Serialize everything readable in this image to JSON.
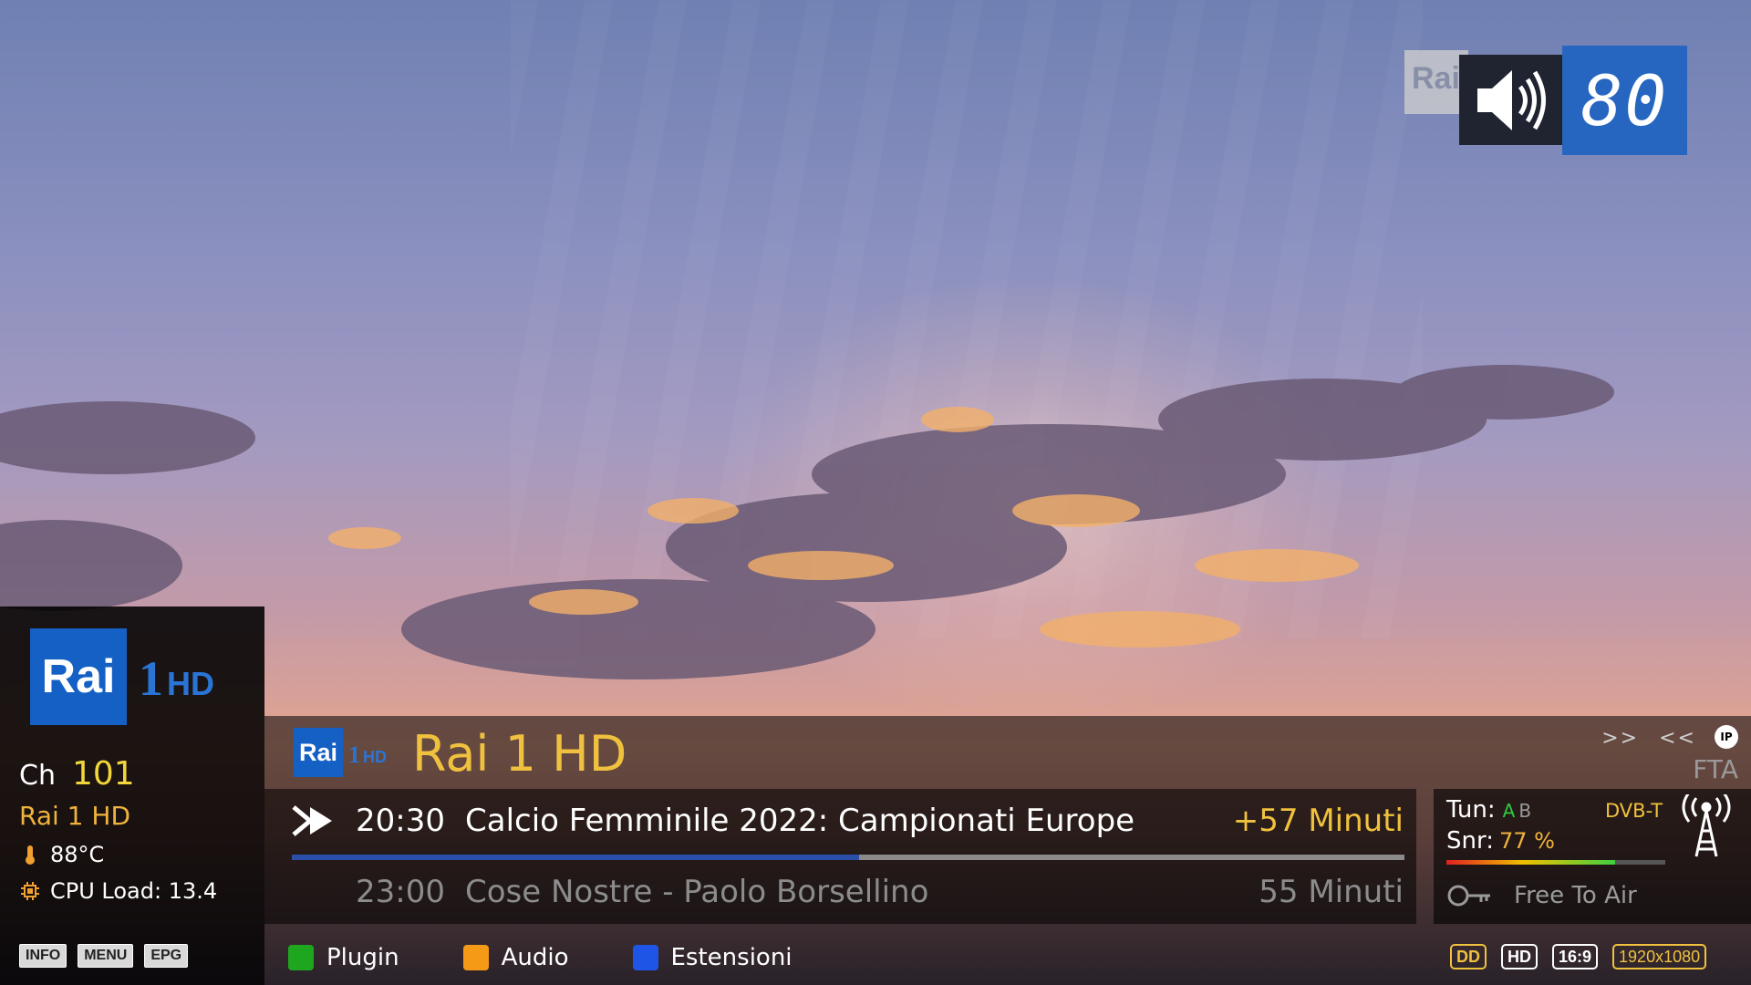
{
  "background": {
    "sky_colors": [
      "#6f80b2",
      "#a49ac0",
      "#e3a48e",
      "#5b4b5d"
    ]
  },
  "volume": {
    "channel_logo_text": "Rai",
    "level": "80",
    "icon": "speaker-icon"
  },
  "left_panel": {
    "logo_text": "Rai",
    "logo_suffix_number": "1",
    "logo_suffix_hd": "HD",
    "ch_label": "Ch",
    "channel_number": "101",
    "channel_name": "Rai 1 HD",
    "temperature": "88°C",
    "cpu_load": "CPU Load: 13.4",
    "keys": [
      "INFO",
      "MENU",
      "EPG"
    ]
  },
  "infobar": {
    "logo_text": "Rai",
    "logo_suffix_number": "1",
    "logo_suffix_hd": "HD",
    "channel_title": "Rai 1 HD",
    "nav_forward": ">>",
    "nav_back": "<<",
    "ip_icon_text": "IP",
    "fta": "FTA",
    "now": {
      "time": "20:30",
      "title": "Calcio Femminile 2022: Campionati Europe",
      "duration": "+57 Minuti",
      "progress_percent": 51
    },
    "next": {
      "time": "23:00",
      "title": "Cose Nostre - Paolo Borsellino",
      "duration": "55 Minuti"
    }
  },
  "tuner": {
    "tun_label": "Tun:",
    "tuner_a": "A",
    "tuner_b": "B",
    "system": "DVB-T",
    "snr_label": "Snr:",
    "snr_value": "77 %",
    "snr_percent": 77,
    "ca_text": "Free To Air"
  },
  "color_keys": [
    {
      "label": "Plugin",
      "color": "#1fa61f"
    },
    {
      "label": "Audio",
      "color": "#f59a16"
    },
    {
      "label": "Estensioni",
      "color": "#1f55e6"
    }
  ],
  "av_badges": {
    "dolby": "DD",
    "hd": "HD",
    "aspect": "16:9",
    "resolution": "1920x1080"
  }
}
